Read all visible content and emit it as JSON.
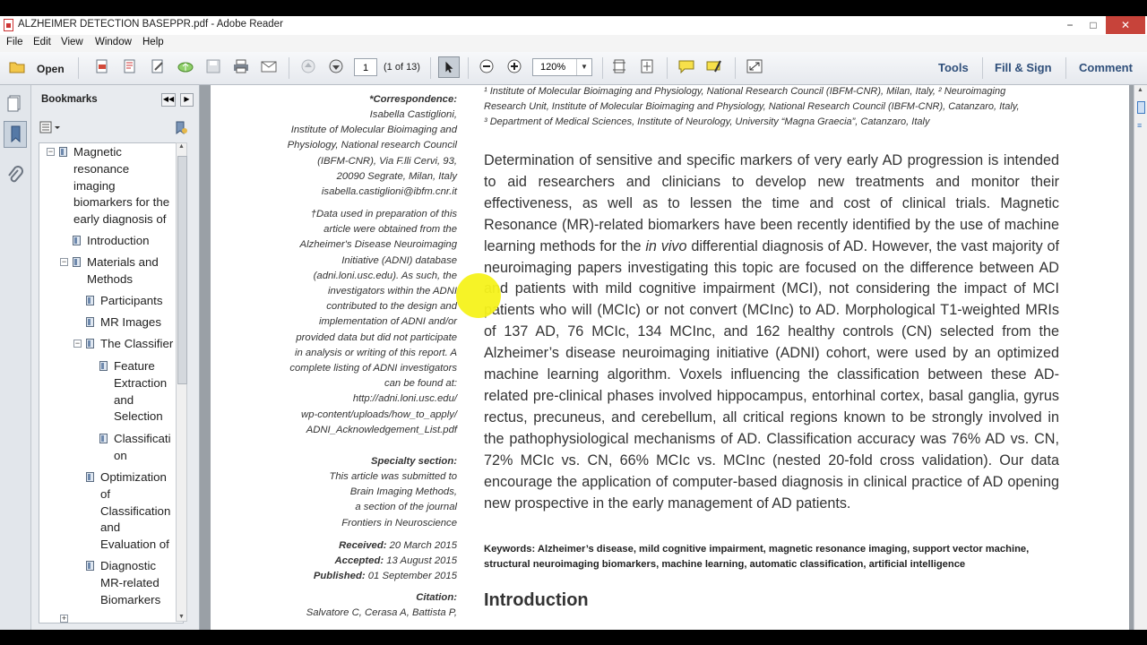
{
  "window": {
    "title": "ALZHEIMER DETECTION BASEPPR.pdf - Adobe Reader",
    "controls": {
      "minimize": "−",
      "maximize": "□",
      "close": "✕"
    }
  },
  "menu": [
    "File",
    "Edit",
    "View",
    "Window",
    "Help"
  ],
  "toolbar": {
    "open_label": "Open",
    "page_value": "1",
    "page_count": "(1 of 13)",
    "zoom_value": "120%",
    "right_links": [
      "Tools",
      "Fill & Sign",
      "Comment"
    ]
  },
  "bookmarks": {
    "heading": "Bookmarks",
    "items": [
      {
        "lines": [
          "Magnetic",
          "resonance",
          "imaging",
          "biomarkers for the",
          "early diagnosis of"
        ]
      },
      {
        "lines": [
          "Introduction"
        ]
      },
      {
        "lines": [
          "Materials and",
          "Methods"
        ]
      },
      {
        "lines": [
          "Participants"
        ]
      },
      {
        "lines": [
          "MR Images"
        ]
      },
      {
        "lines": [
          "The Classifier"
        ]
      },
      {
        "lines": [
          "Feature",
          "Extraction",
          "and",
          "Selection"
        ]
      },
      {
        "lines": [
          "Classificati",
          "on"
        ]
      },
      {
        "lines": [
          "Optimization",
          "of",
          "Classification",
          "and",
          "Evaluation of"
        ]
      },
      {
        "lines": [
          "Diagnostic",
          "MR-related",
          "Biomarkers"
        ]
      }
    ]
  },
  "document": {
    "affiliations": [
      "¹ Institute of Molecular Bioimaging and Physiology, National Research Council (IBFM-CNR), Milan, Italy, ² Neuroimaging",
      "Research Unit, Institute of Molecular Bioimaging and Physiology, National Research Council (IBFM-CNR), Catanzaro, Italy,",
      "³ Department of Medical Sciences, Institute of Neurology, University “Magna Graecia”, Catanzaro, Italy"
    ],
    "correspondence_head": "*Correspondence:",
    "correspondence": [
      "Isabella Castiglioni,",
      "Institute of Molecular Bioimaging and",
      "Physiology, National research Council",
      "(IBFM-CNR), Via F.lli Cervi, 93,",
      "20090 Segrate, Milan, Italy",
      "isabella.castiglioni@ibfm.cnr.it"
    ],
    "adni_note": [
      "†Data used in preparation of this",
      "article were obtained from the",
      "Alzheimer's Disease Neuroimaging",
      "Initiative (ADNI) database",
      "(adni.loni.usc.edu). As such, the",
      "investigators within the ADNI",
      "contributed to the design and",
      "implementation of ADNI and/or",
      "provided data but did not participate",
      "in analysis or writing of this report. A",
      "complete listing of ADNI investigators",
      "can be found at:",
      "http://adni.loni.usc.edu/",
      "wp-content/uploads/how_to_apply/",
      "ADNI_Acknowledgement_List.pdf"
    ],
    "specialty_head": "Specialty section:",
    "specialty": [
      "This article was submitted to",
      "Brain Imaging Methods,",
      "a section of the journal",
      "Frontiers in Neuroscience"
    ],
    "dates": [
      {
        "label": "Received:",
        "value": " 20 March 2015"
      },
      {
        "label": "Accepted:",
        "value": " 13 August 2015"
      },
      {
        "label": "Published:",
        "value": " 01 September 2015"
      }
    ],
    "citation_head": "Citation:",
    "citation": [
      "Salvatore C, Cerasa A, Battista P,"
    ],
    "abstract_before_italic": "Determination of sensitive and specific markers of very early AD progression is intended to aid researchers and clinicians to develop new treatments and monitor their effectiveness, as well as to lessen the time and cost of clinical trials. Magnetic Resonance (MR)-related biomarkers have been recently identified by the use of machine learning methods for the ",
    "abstract_italic": "in vivo",
    "abstract_after_italic": " differential diagnosis of AD. However, the vast majority of neuroimaging papers investigating this topic are focused on the difference between AD and patients with mild cognitive impairment (MCI), not considering the impact of MCI patients who will (MCIc) or not convert (MCInc) to AD. Morphological T1-weighted MRIs of 137 AD, 76 MCIc, 134 MCInc, and 162 healthy controls (CN) selected from the Alzheimer’s disease neuroimaging initiative (ADNI) cohort, were used by an optimized machine learning algorithm. Voxels influencing the classification between these AD-related pre-clinical phases involved hippocampus, entorhinal cortex, basal ganglia, gyrus rectus, precuneus, and cerebellum, all critical regions known to be strongly involved in the pathophysiological mechanisms of AD. Classification accuracy was 76% AD vs. CN, 72% MCIc vs. CN, 66% MCIc vs. MCInc (nested 20-fold cross validation). Our data encourage the application of computer-based diagnosis in clinical practice of AD opening new prospective in the early management of AD patients.",
    "keywords": "Keywords: Alzheimer’s disease, mild cognitive impairment, magnetic resonance imaging, support vector machine, structural neuroimaging biomarkers, machine learning, automatic classification, artificial intelligence",
    "section_heading": "Introduction"
  },
  "colors": {
    "cursor_highlight": "#f6f21b",
    "link_blue": "#2f4f7a"
  }
}
